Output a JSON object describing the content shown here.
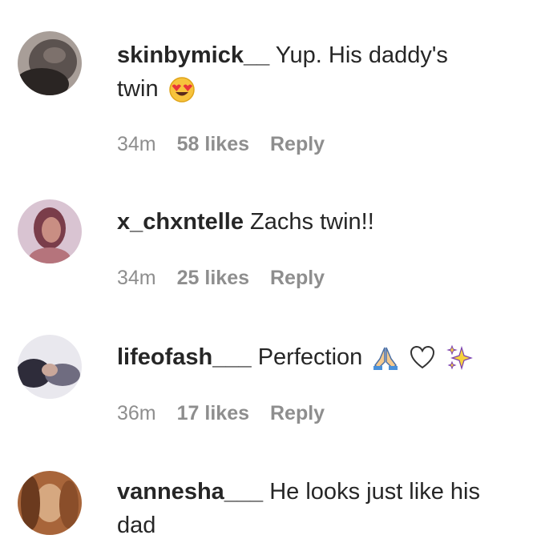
{
  "comments": [
    {
      "username": "skinbymick__",
      "text_line1": "Yup. His daddy's",
      "text_line2": "twin",
      "emojis": [
        "heart-eyes-emoji"
      ],
      "time": "34m",
      "likes": "58 likes",
      "reply": "Reply",
      "avatar_colors": [
        "#5b524f",
        "#2a2523",
        "#a89e98"
      ]
    },
    {
      "username": "x_chxntelle",
      "text": "Zachs twin!!",
      "time": "34m",
      "likes": "25 likes",
      "reply": "Reply",
      "avatar_colors": [
        "#d9c4d2",
        "#7a3d4a",
        "#c98e83"
      ]
    },
    {
      "username": "lifeofash___",
      "text": "Perfection",
      "emojis": [
        "folded-hands-emoji",
        "white-heart-emoji",
        "sparkles-emoji"
      ],
      "time": "36m",
      "likes": "17 likes",
      "reply": "Reply",
      "avatar_colors": [
        "#e9e8ee",
        "#2e2c3a",
        "#6f6c80"
      ]
    },
    {
      "username": "vannesha___",
      "text_line1": "He looks just like his",
      "text_line2": "dad",
      "avatar_colors": [
        "#a8653a",
        "#d6a880",
        "#6b3a1e"
      ]
    }
  ]
}
